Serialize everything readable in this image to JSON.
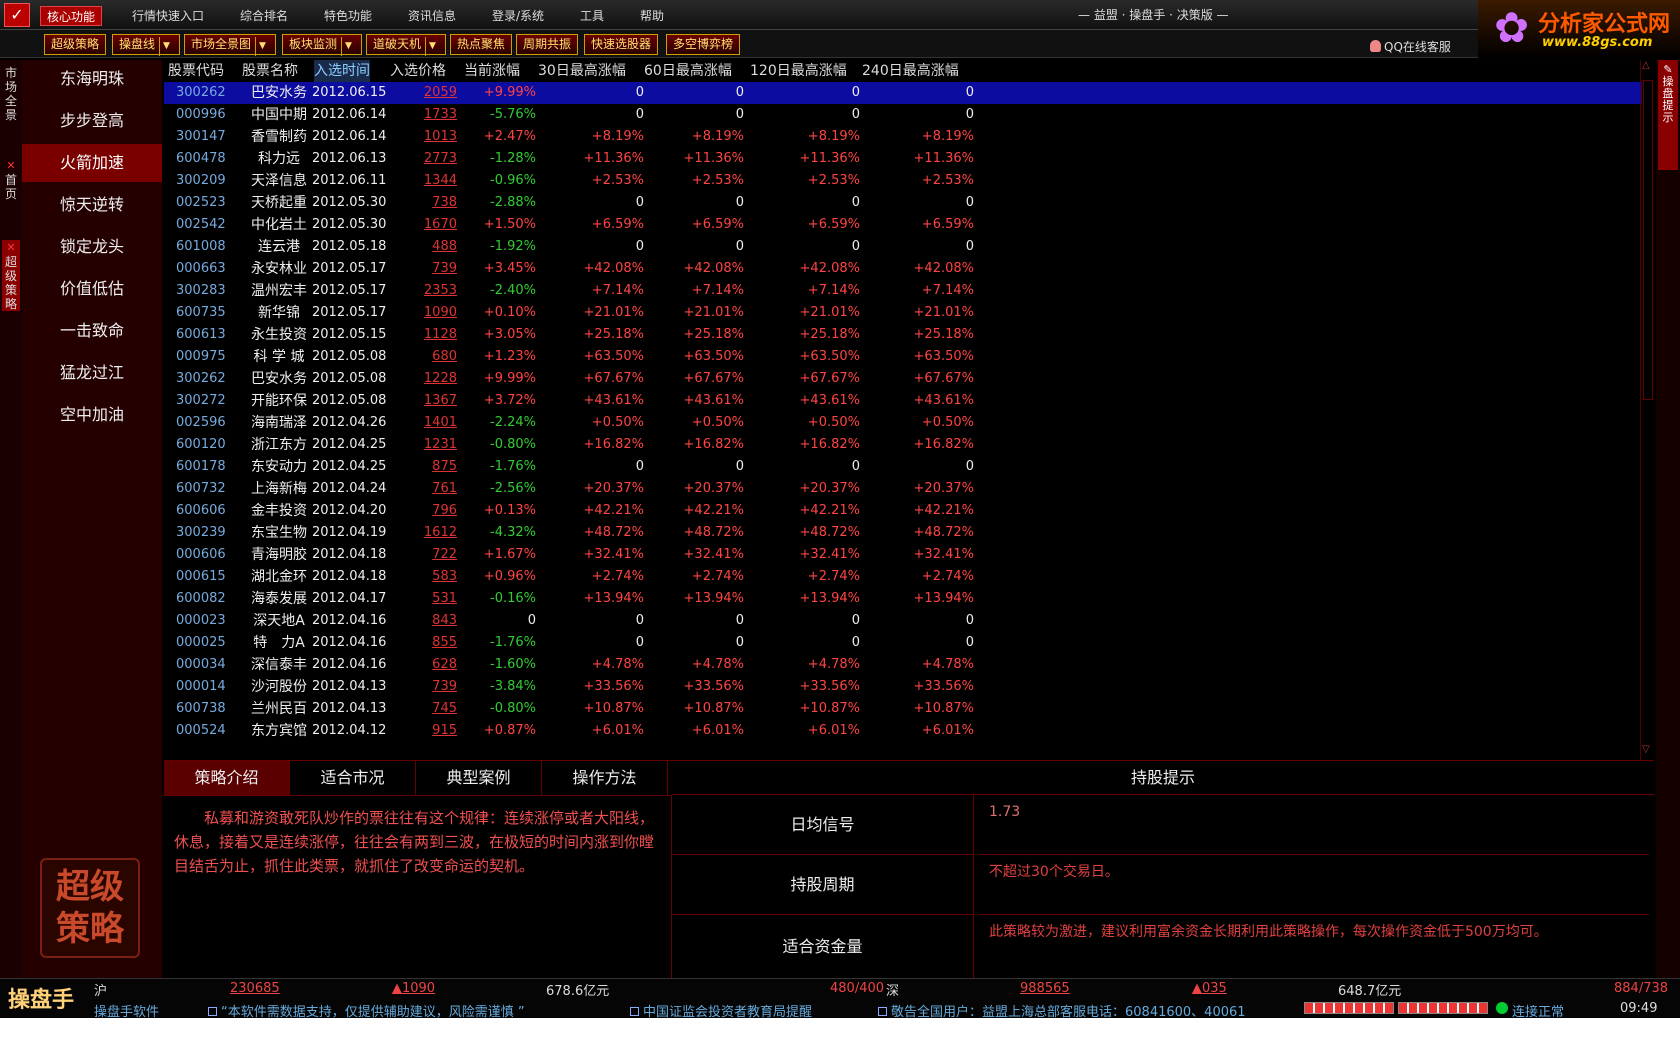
{
  "menu": {
    "items": [
      "核心功能",
      "行情快速入口",
      "综合排名",
      "特色功能",
      "资讯信息",
      "登录/系统",
      "工具",
      "帮助"
    ],
    "window_title": "— 益盟 · 操盘手 · 决策版 —"
  },
  "brand": {
    "name": "分析家公式网",
    "url": "www.88gs.com"
  },
  "toolbar": {
    "buttons": [
      "超级策略",
      "操盘线",
      "市场全景图",
      "板块监测",
      "道破天机",
      "热点聚焦",
      "周期共振",
      "快速选股器",
      "多空博弈榜"
    ],
    "qq_service": "QQ在线客服"
  },
  "left_tabs": {
    "market": "市场全景",
    "home": "首页",
    "strategy": "超级策略"
  },
  "strategies": [
    "东海明珠",
    "步步登高",
    "火箭加速",
    "惊天逆转",
    "锁定龙头",
    "价值低估",
    "一击致命",
    "猛龙过江",
    "空中加油"
  ],
  "seal": {
    "line1": "超级",
    "line2": "策略"
  },
  "grid": {
    "headers": [
      "股票代码",
      "股票名称",
      "入选时间",
      "入选价格",
      "当前涨幅",
      "30日最高涨幅",
      "60日最高涨幅",
      "120日最高涨幅",
      "240日最高涨幅"
    ],
    "rows": [
      [
        "300262",
        "巴安水务",
        "2012.06.15",
        "2059",
        "+9.99%",
        "0",
        "0",
        "0",
        "0"
      ],
      [
        "000996",
        "中国中期",
        "2012.06.14",
        "1733",
        "-5.76%",
        "0",
        "0",
        "0",
        "0"
      ],
      [
        "300147",
        "香雪制药",
        "2012.06.14",
        "1013",
        "+2.47%",
        "+8.19%",
        "+8.19%",
        "+8.19%",
        "+8.19%"
      ],
      [
        "600478",
        "科力远",
        "2012.06.13",
        "2773",
        "-1.28%",
        "+11.36%",
        "+11.36%",
        "+11.36%",
        "+11.36%"
      ],
      [
        "300209",
        "天泽信息",
        "2012.06.11",
        "1344",
        "-0.96%",
        "+2.53%",
        "+2.53%",
        "+2.53%",
        "+2.53%"
      ],
      [
        "002523",
        "天桥起重",
        "2012.05.30",
        "738",
        "-2.88%",
        "0",
        "0",
        "0",
        "0"
      ],
      [
        "002542",
        "中化岩土",
        "2012.05.30",
        "1670",
        "+1.50%",
        "+6.59%",
        "+6.59%",
        "+6.59%",
        "+6.59%"
      ],
      [
        "601008",
        "连云港",
        "2012.05.18",
        "488",
        "-1.92%",
        "0",
        "0",
        "0",
        "0"
      ],
      [
        "000663",
        "永安林业",
        "2012.05.17",
        "739",
        "+3.45%",
        "+42.08%",
        "+42.08%",
        "+42.08%",
        "+42.08%"
      ],
      [
        "300283",
        "温州宏丰",
        "2012.05.17",
        "2353",
        "-2.40%",
        "+7.14%",
        "+7.14%",
        "+7.14%",
        "+7.14%"
      ],
      [
        "600735",
        "新华锦",
        "2012.05.17",
        "1090",
        "+0.10%",
        "+21.01%",
        "+21.01%",
        "+21.01%",
        "+21.01%"
      ],
      [
        "600613",
        "永生投资",
        "2012.05.15",
        "1128",
        "+3.05%",
        "+25.18%",
        "+25.18%",
        "+25.18%",
        "+25.18%"
      ],
      [
        "000975",
        "科 学 城",
        "2012.05.08",
        "680",
        "+1.23%",
        "+63.50%",
        "+63.50%",
        "+63.50%",
        "+63.50%"
      ],
      [
        "300262",
        "巴安水务",
        "2012.05.08",
        "1228",
        "+9.99%",
        "+67.67%",
        "+67.67%",
        "+67.67%",
        "+67.67%"
      ],
      [
        "300272",
        "开能环保",
        "2012.05.08",
        "1367",
        "+3.72%",
        "+43.61%",
        "+43.61%",
        "+43.61%",
        "+43.61%"
      ],
      [
        "002596",
        "海南瑞泽",
        "2012.04.26",
        "1401",
        "-2.24%",
        "+0.50%",
        "+0.50%",
        "+0.50%",
        "+0.50%"
      ],
      [
        "600120",
        "浙江东方",
        "2012.04.25",
        "1231",
        "-0.80%",
        "+16.82%",
        "+16.82%",
        "+16.82%",
        "+16.82%"
      ],
      [
        "600178",
        "东安动力",
        "2012.04.25",
        "875",
        "-1.76%",
        "0",
        "0",
        "0",
        "0"
      ],
      [
        "600732",
        "上海新梅",
        "2012.04.24",
        "761",
        "-2.56%",
        "+20.37%",
        "+20.37%",
        "+20.37%",
        "+20.37%"
      ],
      [
        "600606",
        "金丰投资",
        "2012.04.20",
        "796",
        "+0.13%",
        "+42.21%",
        "+42.21%",
        "+42.21%",
        "+42.21%"
      ],
      [
        "300239",
        "东宝生物",
        "2012.04.19",
        "1612",
        "-4.32%",
        "+48.72%",
        "+48.72%",
        "+48.72%",
        "+48.72%"
      ],
      [
        "000606",
        "青海明胶",
        "2012.04.18",
        "722",
        "+1.67%",
        "+32.41%",
        "+32.41%",
        "+32.41%",
        "+32.41%"
      ],
      [
        "000615",
        "湖北金环",
        "2012.04.18",
        "583",
        "+0.96%",
        "+2.74%",
        "+2.74%",
        "+2.74%",
        "+2.74%"
      ],
      [
        "600082",
        "海泰发展",
        "2012.04.17",
        "531",
        "-0.16%",
        "+13.94%",
        "+13.94%",
        "+13.94%",
        "+13.94%"
      ],
      [
        "000023",
        "深天地A",
        "2012.04.16",
        "843",
        "0",
        "0",
        "0",
        "0",
        "0"
      ],
      [
        "000025",
        "特　力A",
        "2012.04.16",
        "855",
        "-1.76%",
        "0",
        "0",
        "0",
        "0"
      ],
      [
        "000034",
        "深信泰丰",
        "2012.04.16",
        "628",
        "-1.60%",
        "+4.78%",
        "+4.78%",
        "+4.78%",
        "+4.78%"
      ],
      [
        "000014",
        "沙河股份",
        "2012.04.13",
        "739",
        "-3.84%",
        "+33.56%",
        "+33.56%",
        "+33.56%",
        "+33.56%"
      ],
      [
        "600738",
        "兰州民百",
        "2012.04.13",
        "745",
        "-0.80%",
        "+10.87%",
        "+10.87%",
        "+10.87%",
        "+10.87%"
      ],
      [
        "000524",
        "东方宾馆",
        "2012.04.12",
        "915",
        "+0.87%",
        "+6.01%",
        "+6.01%",
        "+6.01%",
        "+6.01%"
      ]
    ]
  },
  "bottom": {
    "tabs": [
      "策略介绍",
      "适合市况",
      "典型案例",
      "操作方法"
    ],
    "description": "私募和游资敢死队炒作的票往往有这个规律：连续涨停或者大阳线，休息，接着又是连续涨停，往往会有两到三波，在极短的时间内涨到你瞠目结舌为止，抓住此类票，就抓住了改变命运的契机。",
    "hold_title": "持股提示",
    "hold": [
      {
        "label": "日均信号",
        "value": "1.73"
      },
      {
        "label": "持股周期",
        "value": "不超过30个交易日。"
      },
      {
        "label": "适合资金量",
        "value": "此策略较为激进，建议利用富余资金长期利用此策略操作，每次操作资金低于500万均可。"
      }
    ]
  },
  "right_panel": {
    "tab": "操盘提示"
  },
  "status": {
    "app_name": "操盘手",
    "sh_label": "沪",
    "sh_index": "230685",
    "sh_change": "▲1090",
    "sh_amount": "678.6亿元",
    "sh_ratio": "480/400",
    "sz_label": "深",
    "sz_index": "988565",
    "sz_change": "▲035",
    "sz_amount": "648.7亿元",
    "sz_ratio": "884/738",
    "ticker1": "操盘手软件",
    "ticker2": "“本软件需数据支持，仅提供辅助建议，风险需谨慎 ”",
    "ticker3": "中国证监会投资者教育局提醒",
    "ticker4": "敬告全国用户：益盟上海总部客服电话：60841600、40061",
    "connection": "连接正常",
    "time": "09:49"
  }
}
